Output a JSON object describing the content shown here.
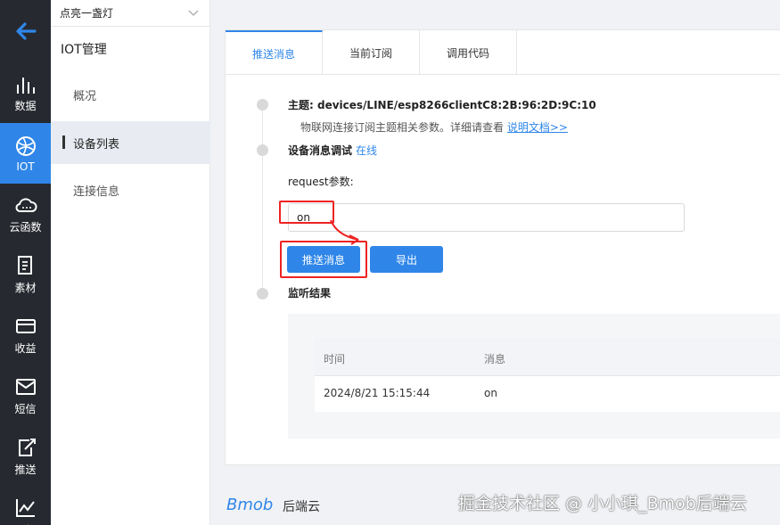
{
  "rail": {
    "items": [
      {
        "label": "数据",
        "icon": "bar-chart-icon"
      },
      {
        "label": "IOT",
        "icon": "globe-icon"
      },
      {
        "label": "云函数",
        "icon": "cloud-icon"
      },
      {
        "label": "素材",
        "icon": "document-icon"
      },
      {
        "label": "收益",
        "icon": "card-icon"
      },
      {
        "label": "短信",
        "icon": "mail-icon"
      },
      {
        "label": "推送",
        "icon": "push-icon"
      },
      {
        "label": "分析",
        "icon": "line-chart-icon"
      }
    ]
  },
  "subnav": {
    "app_name": "点亮一盏灯",
    "section_title": "IOT管理",
    "items": [
      {
        "label": "概况"
      },
      {
        "label": "设备列表"
      },
      {
        "label": "连接信息"
      }
    ]
  },
  "tabs": [
    {
      "label": "推送消息"
    },
    {
      "label": "当前订阅"
    },
    {
      "label": "调用代码"
    }
  ],
  "topic": {
    "label": "主题: devices/LINE/esp8266clientC8:2B:96:2D:9C:10",
    "hint": "物联网连接订阅主题相关参数。详细请查看",
    "doc_link": "说明文档>>"
  },
  "debug": {
    "label": "设备消息调试",
    "status": "在线",
    "param_label": "request参数:",
    "param_value": "on"
  },
  "buttons": {
    "push": "推送消息",
    "export": "导出"
  },
  "results": {
    "label": "监听结果",
    "columns": [
      "时间",
      "消息"
    ],
    "rows": [
      {
        "time": "2024/8/21 15:15:44",
        "message": "on"
      }
    ]
  },
  "footer": {
    "brand": "Bmob",
    "brand_suffix": "后端云",
    "watermark": "掘金技术社区 @ 小小琪_Bmob后端云"
  },
  "colors": {
    "accent": "#2f86e8",
    "rail_bg": "#26292f",
    "annotation": "#e22222"
  }
}
